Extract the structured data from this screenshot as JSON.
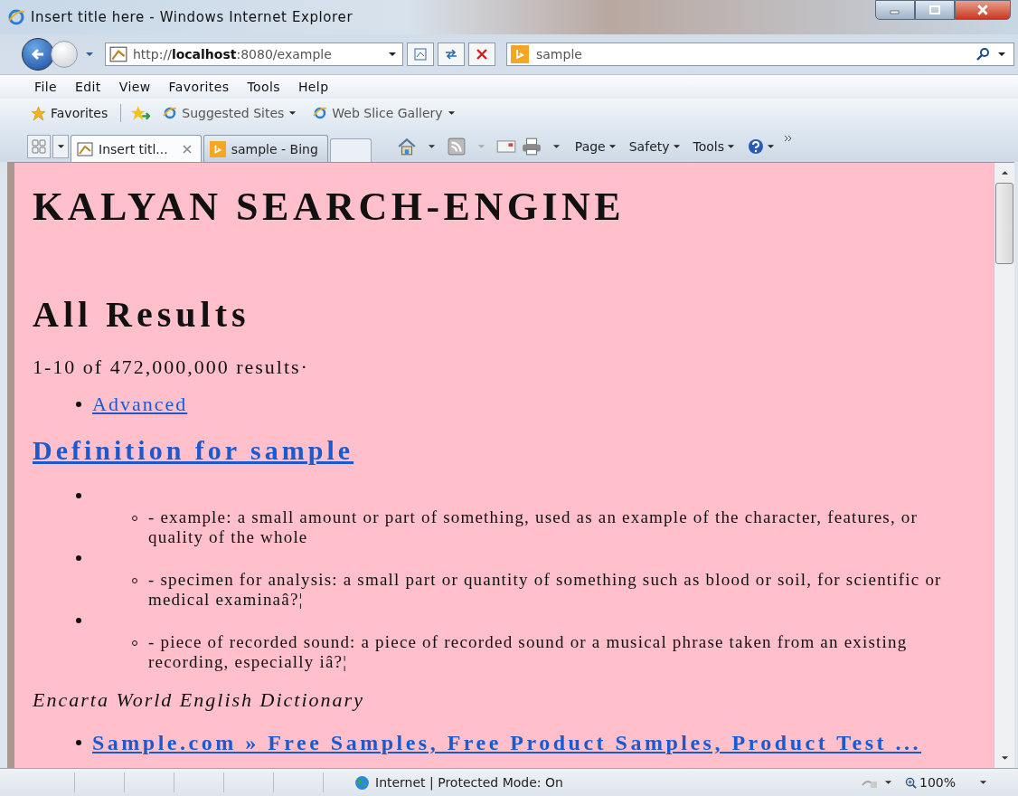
{
  "window": {
    "title": "Insert title here - Windows Internet Explorer"
  },
  "address_bar": {
    "value": "http://**localhost**:8080/example"
  },
  "search_field": {
    "value": "sample"
  },
  "menu": [
    "File",
    "Edit",
    "View",
    "Favorites",
    "Tools",
    "Help"
  ],
  "favorites_bar": {
    "label": "Favorites",
    "links": [
      "Suggested Sites",
      "Web Slice Gallery"
    ]
  },
  "tabs": [
    {
      "label": "Insert titl...",
      "selected": true
    },
    {
      "label": "sample - Bing",
      "selected": false
    }
  ],
  "command_bar": [
    "Page",
    "Safety",
    "Tools"
  ],
  "page": {
    "heading": "KALYAN SEARCH-ENGINE",
    "section_title": "All Results",
    "result_count": "1-10 of 472,000,000 results·",
    "links": [
      "Advanced"
    ],
    "definition_title": "Definition for sample",
    "definitions": [
      "- example: a small amount or part of something, used as an example of the character, features, or quality of the whole",
      "- specimen for analysis: a small part or quantity of something such as blood or soil, for scientific or medical examinaâ?¦",
      "- piece of recorded sound: a piece of recorded sound or a musical phrase taken from an existing recording, especially iâ?¦"
    ],
    "source": "Encarta World English Dictionary",
    "results": [
      "Sample.com » Free Samples, Free Product Samples, Product Test ..."
    ]
  },
  "status_bar": {
    "zone": "Internet | Protected Mode: On",
    "zoom": "100%"
  }
}
